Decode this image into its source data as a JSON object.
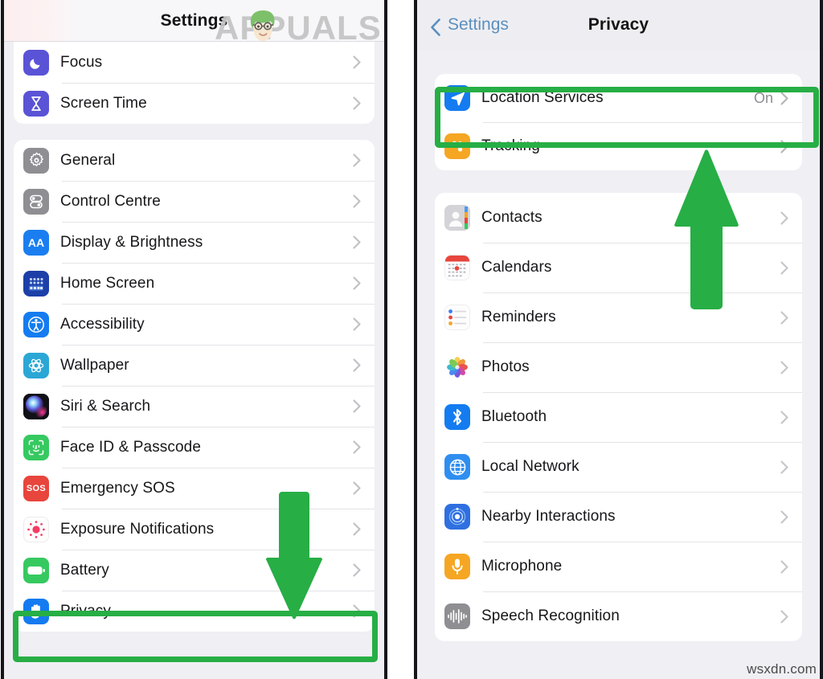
{
  "watermarks": {
    "brand": "APPUALS",
    "source": "wsxdn.com"
  },
  "left_panel": {
    "navbar": {
      "title": "Settings"
    },
    "groups": [
      {
        "id": "group-focus",
        "items": [
          {
            "label": "Focus",
            "icon": "focus-moon-icon",
            "value": "",
            "chevron": true
          },
          {
            "label": "Screen Time",
            "icon": "screen-time-hourglass-icon",
            "value": "",
            "chevron": true
          }
        ]
      },
      {
        "id": "group-system",
        "items": [
          {
            "label": "General",
            "icon": "general-gear-icon",
            "value": "",
            "chevron": true
          },
          {
            "label": "Control Centre",
            "icon": "control-centre-toggles-icon",
            "value": "",
            "chevron": true
          },
          {
            "label": "Display & Brightness",
            "icon": "display-brightness-aa-icon",
            "value": "",
            "chevron": true
          },
          {
            "label": "Home Screen",
            "icon": "home-screen-grid-icon",
            "value": "",
            "chevron": true
          },
          {
            "label": "Accessibility",
            "icon": "accessibility-person-icon",
            "value": "",
            "chevron": true
          },
          {
            "label": "Wallpaper",
            "icon": "wallpaper-flower-icon",
            "value": "",
            "chevron": true
          },
          {
            "label": "Siri & Search",
            "icon": "siri-orb-icon",
            "value": "",
            "chevron": true
          },
          {
            "label": "Face ID & Passcode",
            "icon": "face-id-icon",
            "value": "",
            "chevron": true
          },
          {
            "label": "Emergency SOS",
            "icon": "emergency-sos-icon",
            "value": "",
            "chevron": true
          },
          {
            "label": "Exposure Notifications",
            "icon": "exposure-notifications-icon",
            "value": "",
            "chevron": true
          },
          {
            "label": "Battery",
            "icon": "battery-icon",
            "value": "",
            "chevron": true
          },
          {
            "label": "Privacy",
            "icon": "privacy-hand-icon",
            "value": "",
            "chevron": true
          }
        ]
      }
    ]
  },
  "right_panel": {
    "navbar": {
      "back_label": "Settings",
      "title": "Privacy"
    },
    "groups": [
      {
        "id": "group-location",
        "items": [
          {
            "label": "Location Services",
            "icon": "location-arrow-icon",
            "value": "On",
            "chevron": true
          },
          {
            "label": "Tracking",
            "icon": "tracking-icon",
            "value": "",
            "chevron": true
          }
        ]
      },
      {
        "id": "group-permissions",
        "items": [
          {
            "label": "Contacts",
            "icon": "contacts-icon",
            "value": "",
            "chevron": true
          },
          {
            "label": "Calendars",
            "icon": "calendars-icon",
            "value": "",
            "chevron": true
          },
          {
            "label": "Reminders",
            "icon": "reminders-icon",
            "value": "",
            "chevron": true
          },
          {
            "label": "Photos",
            "icon": "photos-icon",
            "value": "",
            "chevron": true
          },
          {
            "label": "Bluetooth",
            "icon": "bluetooth-icon",
            "value": "",
            "chevron": true
          },
          {
            "label": "Local Network",
            "icon": "local-network-globe-icon",
            "value": "",
            "chevron": true
          },
          {
            "label": "Nearby Interactions",
            "icon": "nearby-interactions-icon",
            "value": "",
            "chevron": true
          },
          {
            "label": "Microphone",
            "icon": "microphone-icon",
            "value": "",
            "chevron": true
          },
          {
            "label": "Speech Recognition",
            "icon": "speech-recognition-icon",
            "value": "",
            "chevron": true
          }
        ]
      }
    ]
  },
  "annotations": {
    "highlight_color": "#27ae45",
    "arrow_color": "#27ae45",
    "highlight_privacy": "Privacy",
    "highlight_location_services": "Location Services",
    "arrow_down_target": "Privacy",
    "arrow_up_target": "Location Services"
  }
}
